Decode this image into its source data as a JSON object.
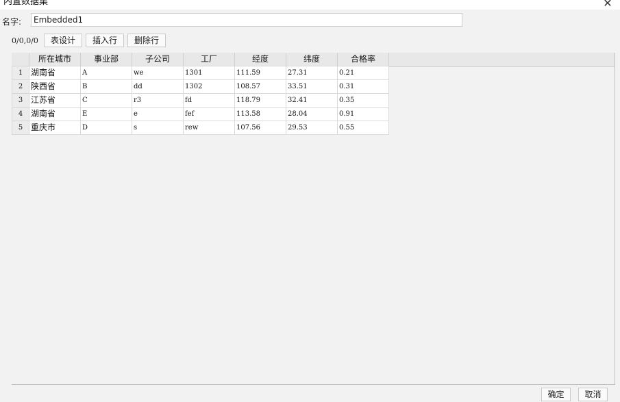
{
  "window": {
    "title": "内置数据集",
    "close_glyph": "✕"
  },
  "name_field": {
    "label": "名字:",
    "value": "Embedded1"
  },
  "toolbar": {
    "cell_ref": "0/0,0/0",
    "design_label": "表设计",
    "insert_label": "插入行",
    "delete_label": "删除行"
  },
  "grid": {
    "columns": [
      "所在城市",
      "事业部",
      "子公司",
      "工厂",
      "经度",
      "纬度",
      "合格率"
    ],
    "rows": [
      {
        "num": "1",
        "cells": [
          "湖南省",
          "A",
          "we",
          "1301",
          "111.59",
          "27.31",
          "0.21"
        ]
      },
      {
        "num": "2",
        "cells": [
          "陕西省",
          "B",
          "dd",
          "1302",
          "108.57",
          "33.51",
          "0.31"
        ]
      },
      {
        "num": "3",
        "cells": [
          "江苏省",
          "C",
          "r3",
          "fd",
          "118.79",
          "32.41",
          "0.35"
        ]
      },
      {
        "num": "4",
        "cells": [
          "湖南省",
          "E",
          "e",
          "fef",
          "113.58",
          "28.04",
          "0.91"
        ]
      },
      {
        "num": "5",
        "cells": [
          "重庆市",
          "D",
          "s",
          "rew",
          "107.56",
          "29.53",
          "0.55"
        ]
      }
    ]
  },
  "footer": {
    "ok_label": "确定",
    "cancel_label": "取消"
  }
}
